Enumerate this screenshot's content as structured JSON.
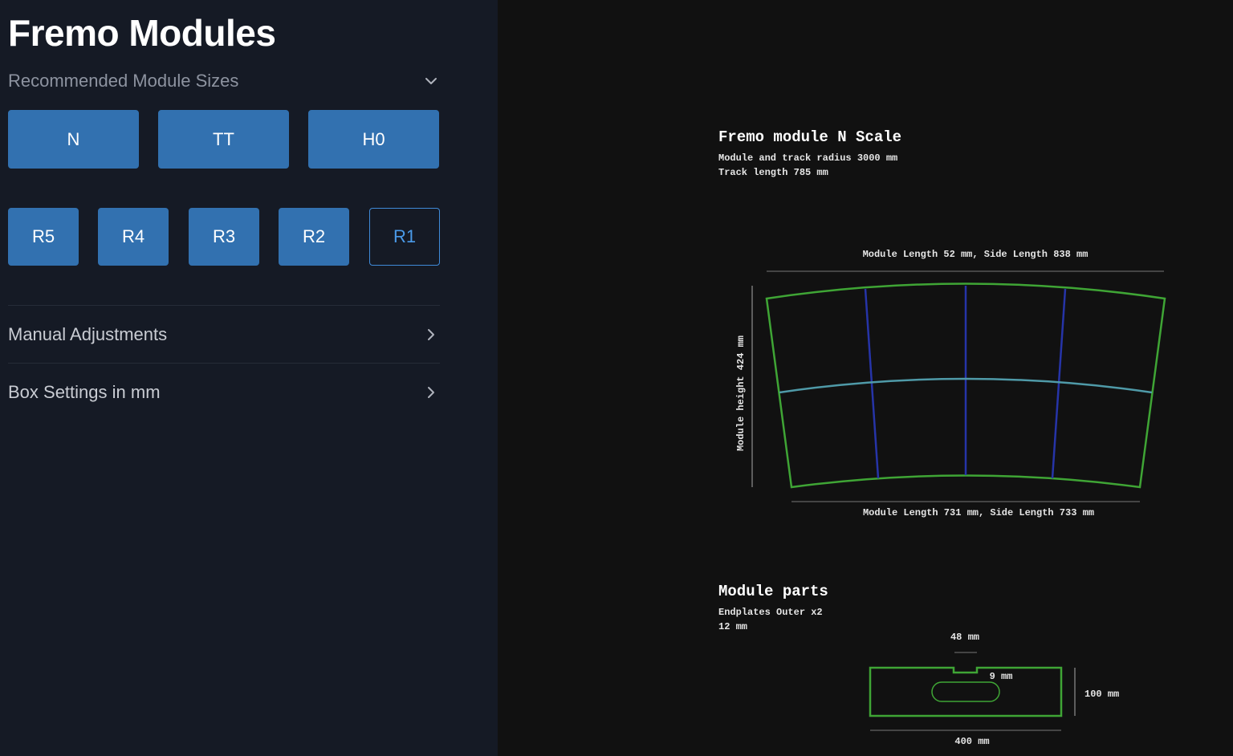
{
  "sidebar": {
    "title": "Fremo Modules",
    "recommended": {
      "label": "Recommended Module Sizes",
      "expanded": true,
      "scales": [
        "N",
        "TT",
        "H0"
      ],
      "radii": [
        "R5",
        "R4",
        "R3",
        "R2",
        "R1"
      ],
      "selected_radius": "R1"
    },
    "manual_adjustments": {
      "label": "Manual Adjustments",
      "expanded": false
    },
    "box_settings": {
      "label": "Box Settings in mm",
      "expanded": false
    }
  },
  "drawing": {
    "title": "Fremo module N Scale",
    "subtitle_lines": [
      "Module and track radius 3000 mm",
      "Track length 785 mm"
    ],
    "top_dimension": "Module Length 52 mm, Side Length 838 mm",
    "bottom_dimension": "Module Length 731 mm, Side Length 733 mm",
    "height_dimension": "Module height 424 mm"
  },
  "parts": {
    "title": "Module parts",
    "subtitle_lines": [
      "Endplates Outer x2",
      "12 mm"
    ],
    "width_top": "48 mm",
    "slot": "9 mm",
    "height": "100 mm",
    "width_bottom": "400 mm"
  },
  "colors": {
    "sidebar_bg": "#151a25",
    "canvas_bg": "#111111",
    "button_blue": "#3271b0",
    "outline_green": "#3fa535",
    "sleeper_blue": "#2634a8",
    "track_teal": "#4f9aa8"
  }
}
